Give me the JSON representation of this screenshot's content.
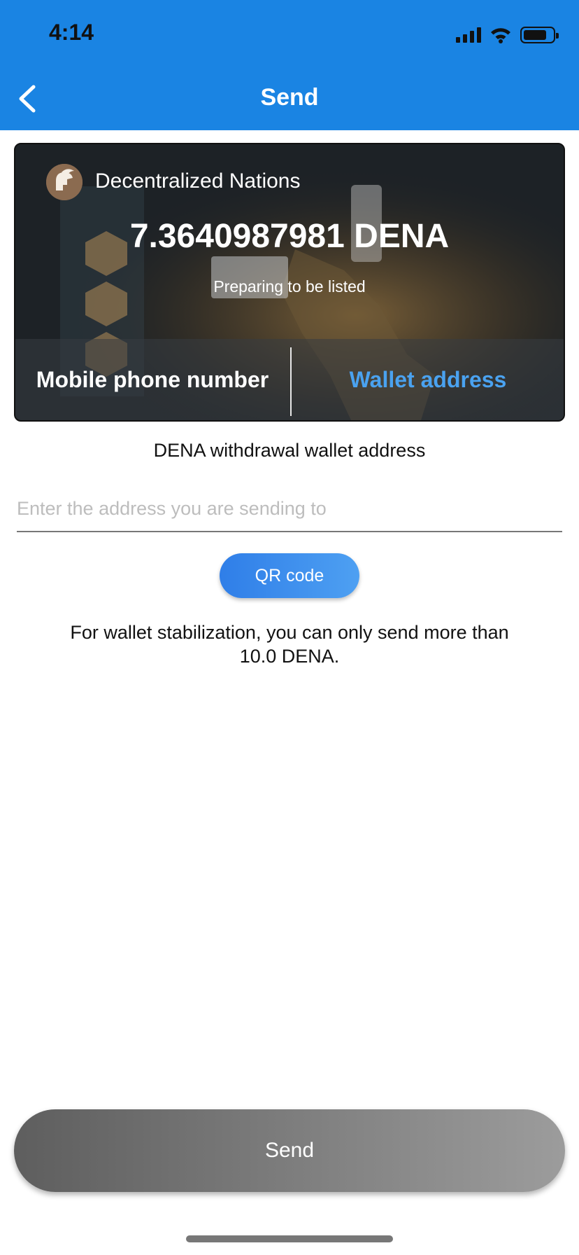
{
  "status_bar": {
    "time": "4:14"
  },
  "nav": {
    "title": "Send"
  },
  "card": {
    "token_name": "Decentralized Nations",
    "balance": "7.3640987981 DENA",
    "listing_status": "Preparing to be listed",
    "tabs": [
      {
        "label": "Mobile phone number",
        "active": false
      },
      {
        "label": "Wallet address",
        "active": true
      }
    ]
  },
  "form": {
    "field_label": "DENA withdrawal wallet address",
    "address_placeholder": "Enter the address you are sending to",
    "address_value": "",
    "qr_button_label": "QR code",
    "notice_line1": "For wallet stabilization, you can only send more than",
    "notice_line2": "10.0 DENA."
  },
  "footer": {
    "send_button_label": "Send"
  },
  "colors": {
    "header": "#1a84e3",
    "active_tab": "#4aa2f0",
    "qr_button": "#3b8deb",
    "send_button": "#7a7a7a"
  }
}
